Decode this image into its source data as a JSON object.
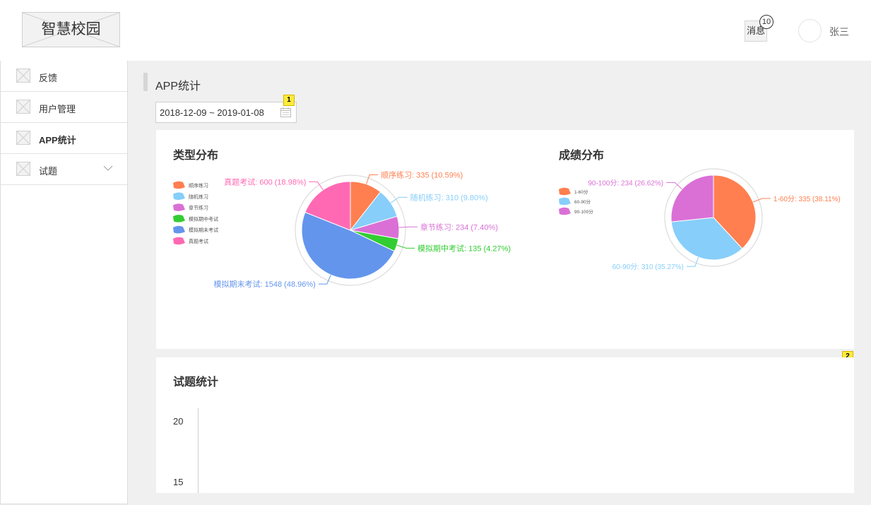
{
  "header": {
    "logo_text": "智慧校园",
    "message_label": "消息",
    "message_count": "10",
    "user_name": "张三"
  },
  "sidebar": {
    "items": [
      {
        "label": "反馈",
        "active": false
      },
      {
        "label": "用户管理",
        "active": false
      },
      {
        "label": "APP统计",
        "active": true
      },
      {
        "label": "试题",
        "active": false,
        "has_submenu": true
      }
    ]
  },
  "main": {
    "page_title": "APP统计",
    "date_range": "2018-12-09 ~ 2019-01-08",
    "markers": [
      "1",
      "2"
    ]
  },
  "colors": {
    "accent_orange": "#ff7f50",
    "accent_skyblue": "#87cefa",
    "accent_orchid": "#da70d6",
    "accent_green": "#32cd32",
    "accent_blue": "#6495ed",
    "accent_pink": "#ff69b4"
  },
  "chart_data": [
    {
      "type": "pie",
      "title": "类型分布",
      "legend": [
        "顺序练习",
        "随机练习",
        "章节练习",
        "模拟期中考试",
        "模拟期末考试",
        "真题考试"
      ],
      "legend_placement": "left",
      "slices": [
        {
          "name": "顺序练习",
          "value": 335,
          "label": "顺序练习: 335 (10.59%)",
          "color": "#ff7f50"
        },
        {
          "name": "随机练习",
          "value": 310,
          "label": "随机练习: 310 (9.80%)",
          "color": "#87cefa"
        },
        {
          "name": "章节练习",
          "value": 234,
          "label": "章节练习: 234 (7.40%)",
          "color": "#da70d6"
        },
        {
          "name": "模拟期中考试",
          "value": 135,
          "label": "模拟期中考试: 135 (4.27%)",
          "color": "#32cd32"
        },
        {
          "name": "模拟期末考试",
          "value": 1548,
          "label": "模拟期末考试: 1548 (48.96%)",
          "color": "#6495ed"
        },
        {
          "name": "真题考试",
          "value": 600,
          "label": "真题考试: 600 (18.98%)",
          "color": "#ff69b4"
        }
      ]
    },
    {
      "type": "pie",
      "title": "成绩分布",
      "legend": [
        "1-60分",
        "60-90分",
        "90-100分"
      ],
      "legend_placement": "left",
      "slices": [
        {
          "name": "1-60分",
          "value": 335,
          "label": "1-60分: 335 (38.11%)",
          "color": "#ff7f50"
        },
        {
          "name": "60-90分",
          "value": 310,
          "label": "60-90分: 310 (35.27%)",
          "color": "#87cefa"
        },
        {
          "name": "90-100分",
          "value": 234,
          "label": "90-100分: 234 (26.62%)",
          "color": "#da70d6"
        }
      ]
    },
    {
      "type": "bar",
      "title": "试题统计",
      "yticks": [
        "20",
        "15"
      ],
      "values": []
    }
  ]
}
